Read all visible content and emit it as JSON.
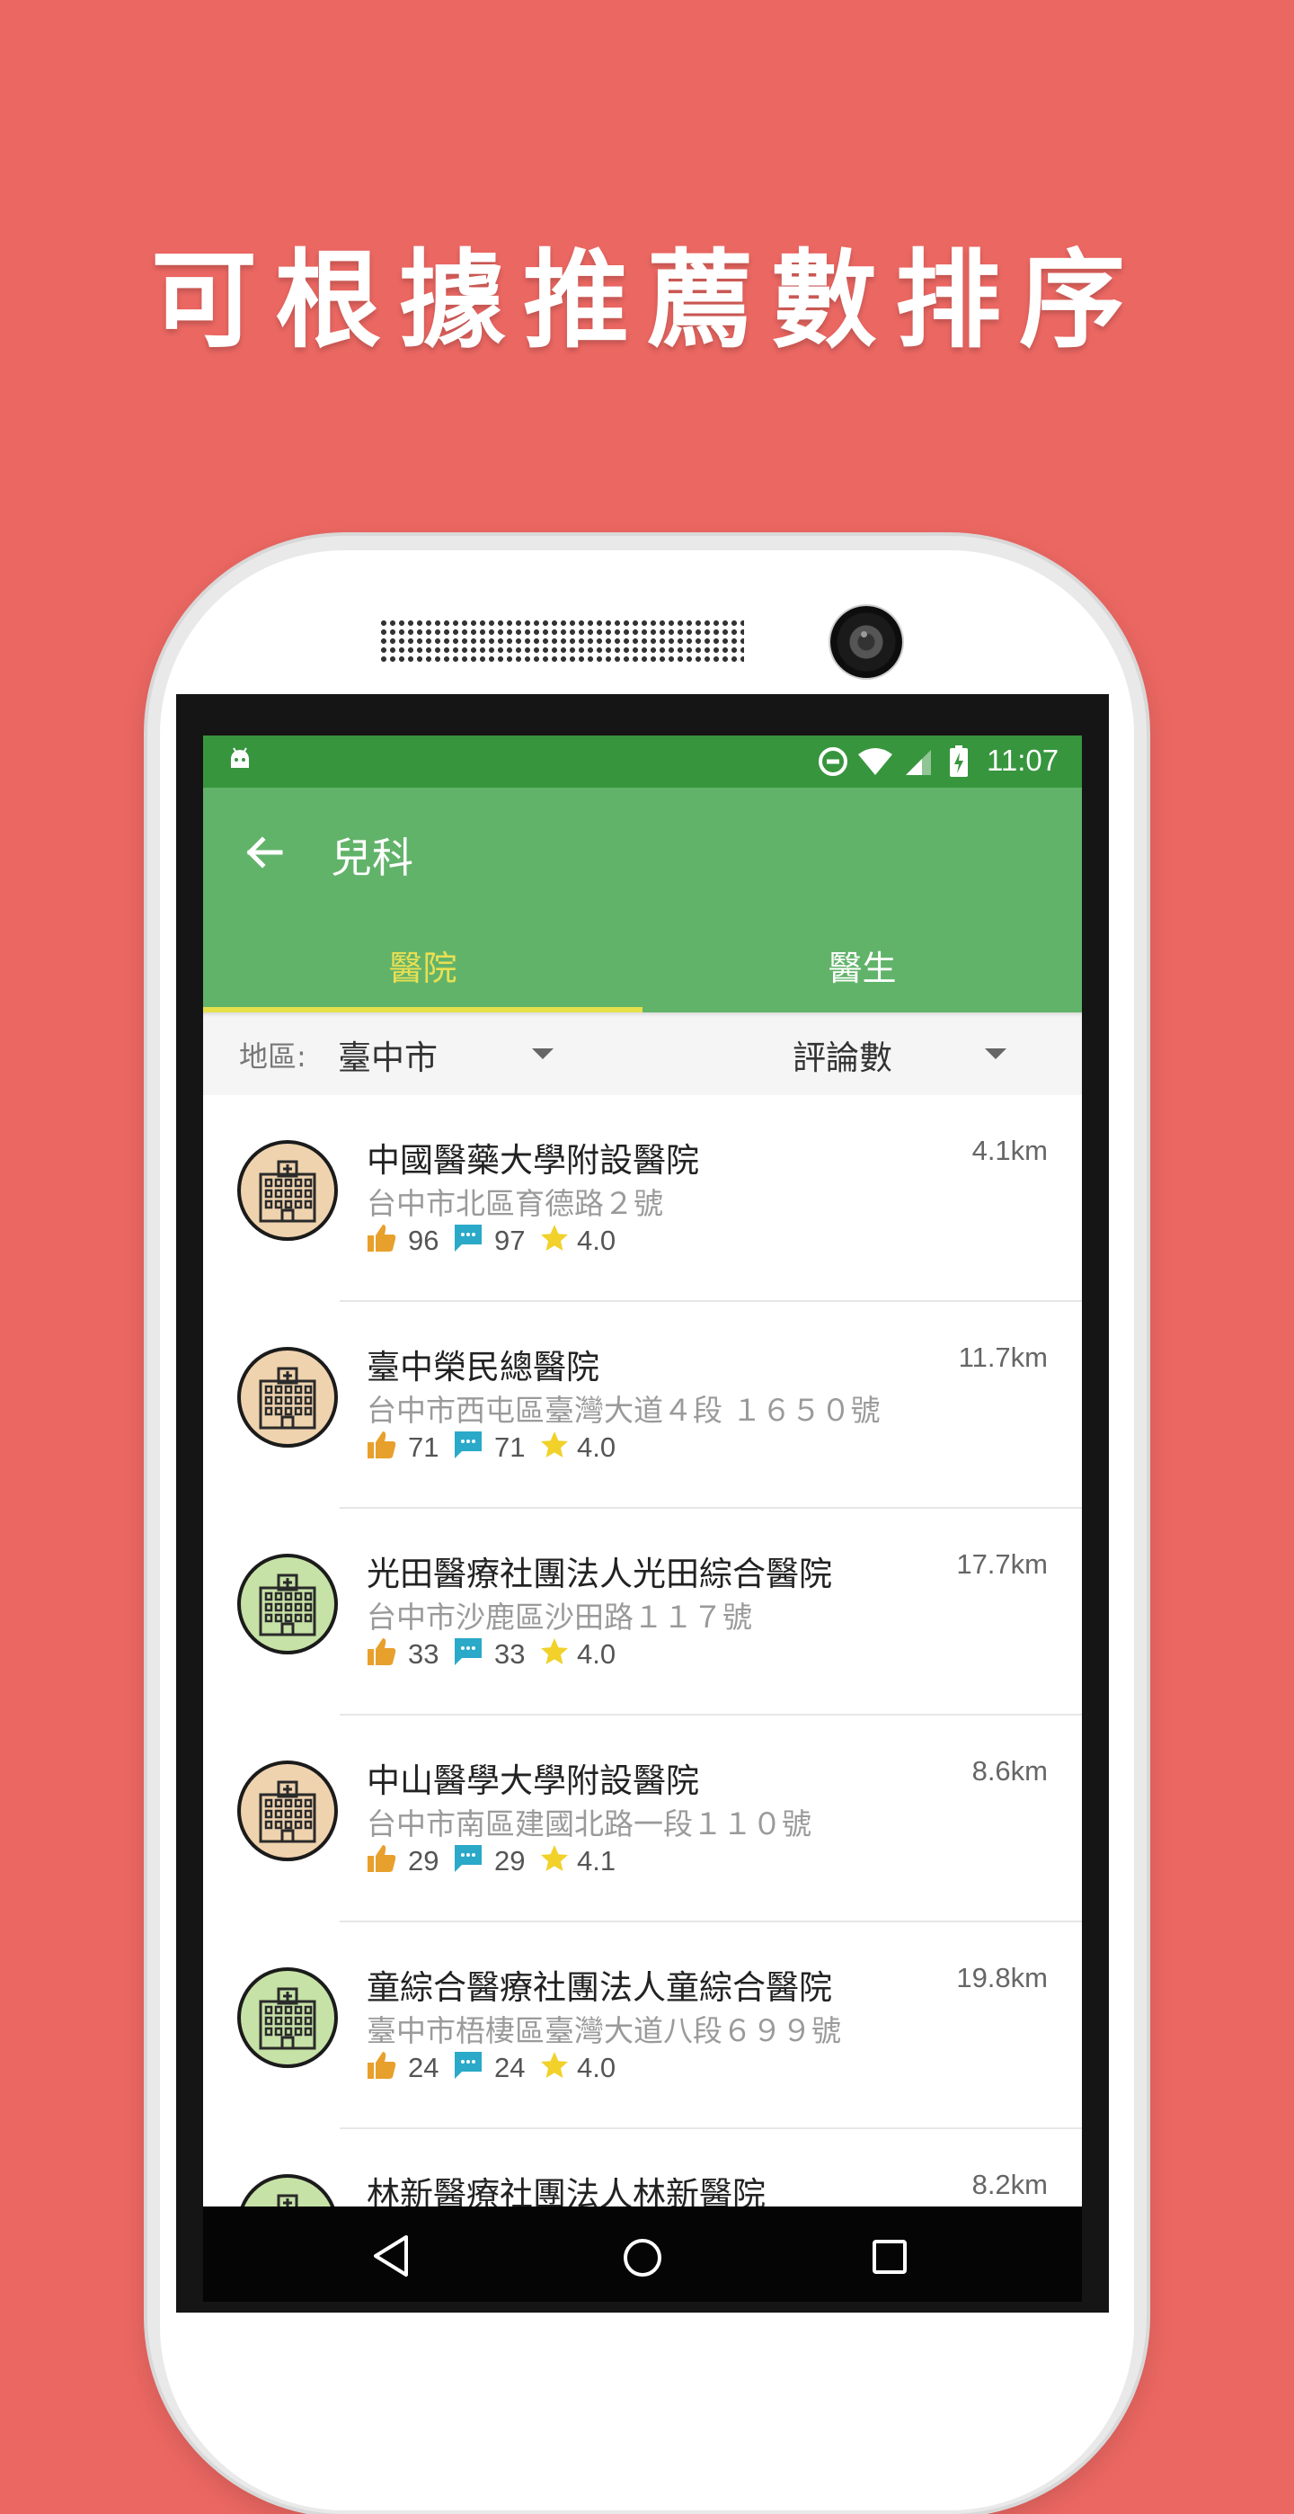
{
  "headline": "可根據推薦數排序",
  "status_bar": {
    "time": "11:07"
  },
  "app_bar": {
    "title": "兒科"
  },
  "tabs": [
    {
      "label": "醫院",
      "selected": true
    },
    {
      "label": "醫生",
      "selected": false
    }
  ],
  "filter": {
    "region_label": "地區:",
    "region_value": "臺中市",
    "sort_value": "評論數"
  },
  "hospitals": [
    {
      "name": "中國醫藥大學附設醫院",
      "distance": "4.1km",
      "address": "台中市北區育德路２號",
      "likes": "96",
      "comments": "97",
      "rating": "4.0",
      "avatar_color": "#EFD3AE"
    },
    {
      "name": "臺中榮民總醫院",
      "distance": "11.7km",
      "address": "台中市西屯區臺灣大道４段 １６５０號",
      "likes": "71",
      "comments": "71",
      "rating": "4.0",
      "avatar_color": "#EFD3AE"
    },
    {
      "name": "光田醫療社團法人光田綜合醫院",
      "distance": "17.7km",
      "address": "台中市沙鹿區沙田路１１７號",
      "likes": "33",
      "comments": "33",
      "rating": "4.0",
      "avatar_color": "#C6E2A6"
    },
    {
      "name": "中山醫學大學附設醫院",
      "distance": "8.6km",
      "address": "台中市南區建國北路一段１１０號",
      "likes": "29",
      "comments": "29",
      "rating": "4.1",
      "avatar_color": "#EFD3AE"
    },
    {
      "name": "童綜合醫療社團法人童綜合醫院",
      "distance": "19.8km",
      "address": "臺中市梧棲區臺灣大道八段６９９號",
      "likes": "24",
      "comments": "24",
      "rating": "4.0",
      "avatar_color": "#C6E2A6"
    },
    {
      "name": "林新醫療社團法人林新醫院",
      "distance": "8.2km",
      "address": "",
      "likes": "",
      "comments": "",
      "rating": "",
      "avatar_color": "#C6E2A6"
    }
  ],
  "colors": {
    "background": "#EB6762",
    "status_bar": "#37953E",
    "app_bar": "#62B36A",
    "tab_selected": "#E9E052",
    "like_icon": "#E8A02C",
    "comment_icon": "#2AA9C8",
    "star_icon": "#F1D12A"
  },
  "icons": {
    "back": "arrow-left-icon",
    "hospital": "hospital-building-icon",
    "like": "thumbs-up-icon",
    "comment": "comment-icon",
    "rating": "star-icon",
    "dropdown": "triangle-down-icon",
    "nav_back": "nav-back-icon",
    "nav_home": "nav-home-icon",
    "nav_recent": "nav-recent-icon"
  }
}
